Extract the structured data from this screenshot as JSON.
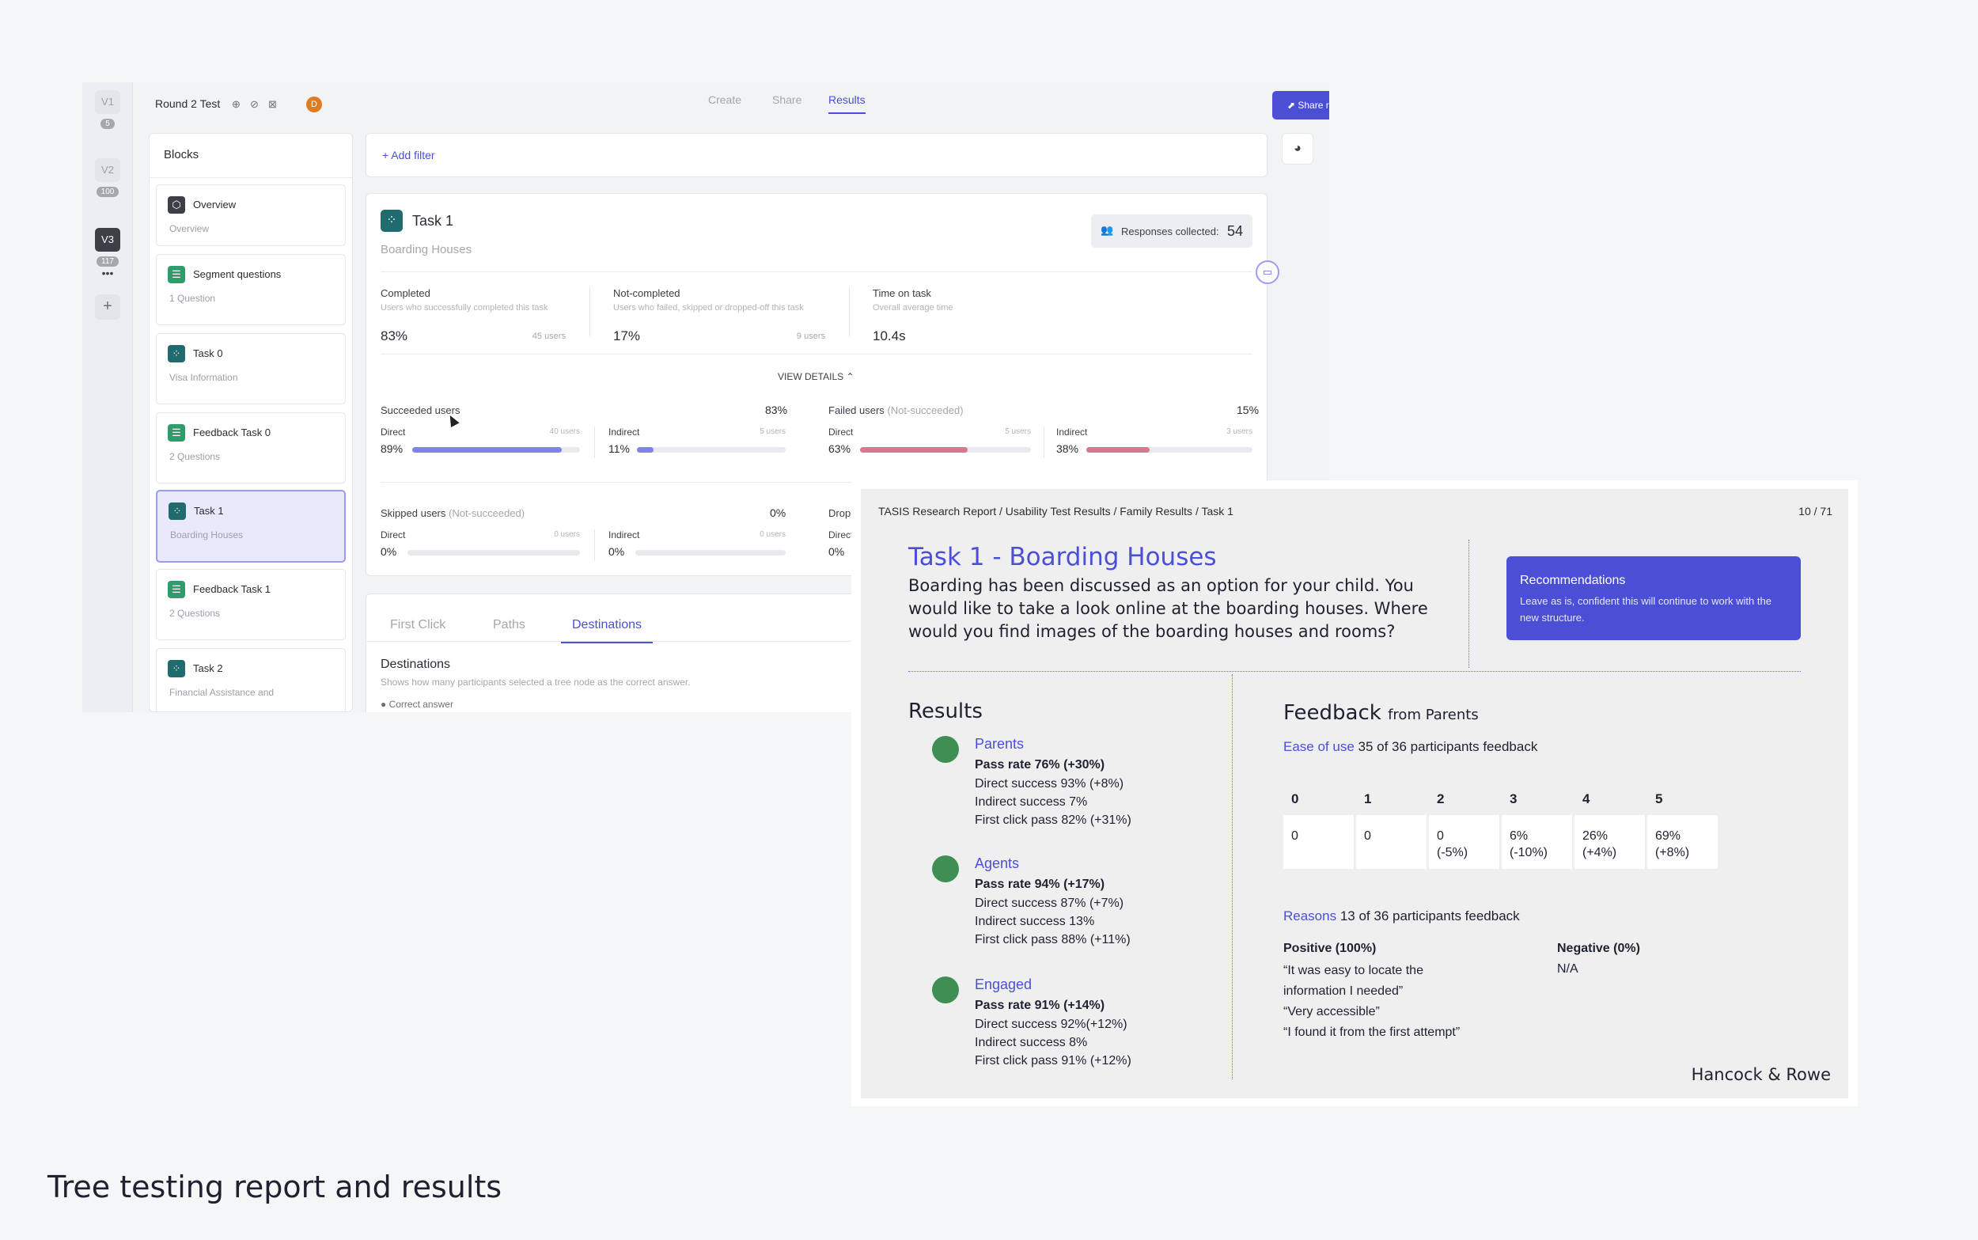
{
  "app": {
    "versions": [
      {
        "label": "V1",
        "count": "5"
      },
      {
        "label": "V2",
        "count": "100"
      },
      {
        "label": "V3",
        "count": "117"
      }
    ],
    "add_version": "+",
    "project_title": "Round 2 Test",
    "avatar": "D",
    "nav_tabs": [
      {
        "label": "Create"
      },
      {
        "label": "Share"
      },
      {
        "label": "Results"
      }
    ],
    "share_button": "⬈ Share results",
    "blocks_title": "Blocks",
    "blocks": [
      {
        "icon": "⬡",
        "title": "Overview",
        "subtitle": "Overview"
      },
      {
        "icon": "☰",
        "title": "Segment questions",
        "subtitle": "1 Question"
      },
      {
        "icon": "⁘",
        "title": "Task 0",
        "subtitle": "Visa Information"
      },
      {
        "icon": "☰",
        "title": "Feedback Task 0",
        "subtitle": "2 Questions"
      },
      {
        "icon": "⁘",
        "title": "Task 1",
        "subtitle": "Boarding Houses"
      },
      {
        "icon": "☰",
        "title": "Feedback Task 1",
        "subtitle": "2 Questions"
      },
      {
        "icon": "⁘",
        "title": "Task 2",
        "subtitle": "Financial Assistance and"
      }
    ],
    "add_filter": "+  Add filter",
    "task": {
      "title": "Task 1",
      "subtitle": "Boarding Houses",
      "responses_label": "Responses collected:",
      "responses_value": "54",
      "stats": [
        {
          "label": "Completed",
          "desc": "Users who successfully completed this task",
          "value": "83%",
          "users": "45 users"
        },
        {
          "label": "Not-completed",
          "desc": "Users who failed, skipped or dropped-off this task",
          "value": "17%",
          "users": "9 users"
        },
        {
          "label": "Time on task",
          "desc": "Overall average time",
          "value": "10.4s",
          "users": ""
        }
      ],
      "view_details": "VIEW DETAILS ⌃",
      "groups": {
        "succeeded": {
          "label": "Succeeded users",
          "muted": "",
          "pct": "83%",
          "direct": {
            "label": "Direct",
            "users": "40 users",
            "pct": "89%",
            "fill": 0.89
          },
          "indirect": {
            "label": "Indirect",
            "users": "5 users",
            "pct": "11%",
            "fill": 0.11
          }
        },
        "failed": {
          "label": "Failed users",
          "muted": "(Not-succeeded)",
          "pct": "15%",
          "direct": {
            "label": "Direct",
            "users": "5 users",
            "pct": "63%",
            "fill": 0.63
          },
          "indirect": {
            "label": "Indirect",
            "users": "3 users",
            "pct": "38%",
            "fill": 0.38
          }
        },
        "skipped": {
          "label": "Skipped users",
          "muted": "(Not-succeeded)",
          "pct": "0%",
          "direct": {
            "label": "Direct",
            "users": "0 users",
            "pct": "0%",
            "fill": 0
          },
          "indirect": {
            "label": "Indirect",
            "users": "0 users",
            "pct": "0%",
            "fill": 0
          }
        },
        "dropped": {
          "label": "Drop",
          "direct_label": "Direct",
          "direct_pct": "0%"
        }
      },
      "colors": {
        "success": "#7f83ee",
        "fail": "#d57a8c",
        "accent": "#4b4fd6"
      }
    },
    "subtabs": [
      {
        "label": "First Click"
      },
      {
        "label": "Paths"
      },
      {
        "label": "Destinations"
      }
    ],
    "destinations_title": "Destinations",
    "destinations_desc": "Shows how many participants selected a tree node as the correct answer.",
    "correct_answer": "● Correct answer"
  },
  "slide": {
    "breadcrumb": "TASIS Research Report / Usability Test Results / Family Results / Task 1",
    "page": "10 / 71",
    "title": "Task 1 - Boarding Houses",
    "question": "Boarding has been discussed as an option for your child. You would like to take a look online at the boarding houses. Where would you find images of the boarding houses and rooms?",
    "recommendations_title": "Recommendations",
    "recommendations_text": "Leave as is, confident this will continue to work with the new structure.",
    "results_heading": "Results",
    "segments": [
      {
        "name": "Parents",
        "pass": "Pass rate 76% (+30%)",
        "lines": [
          "Direct success 93% (+8%)",
          "Indirect success 7%",
          "First click pass 82% (+31%)"
        ]
      },
      {
        "name": "Agents",
        "pass": "Pass rate 94% (+17%)",
        "lines": [
          "Direct success 87% (+7%)",
          "Indirect success 13%",
          "First click pass 88% (+11%)"
        ]
      },
      {
        "name": "Engaged",
        "pass": "Pass rate 91% (+14%)",
        "lines": [
          "Direct success 92%(+12%)",
          "Indirect success 8%",
          "First click pass 91% (+12%)"
        ]
      }
    ],
    "feedback_heading": "Feedback",
    "feedback_from": "from Parents",
    "ease_label": "Ease of use",
    "ease_count": "35 of 36 participants feedback",
    "ease_table": [
      {
        "head": "0",
        "value": "0"
      },
      {
        "head": "1",
        "value": "0"
      },
      {
        "head": "2",
        "value": "0\n(-5%)"
      },
      {
        "head": "3",
        "value": "6%\n(-10%)"
      },
      {
        "head": "4",
        "value": "26%\n(+4%)"
      },
      {
        "head": "5",
        "value": "69%\n(+8%)"
      }
    ],
    "reasons_label": "Reasons",
    "reasons_count": "13 of 36 participants feedback",
    "positive_heading": "Positive (100%)",
    "positive_quotes": [
      "“It was easy to locate the",
      "information I needed”",
      "“Very accessible”",
      "“I found it from the first attempt”"
    ],
    "negative_heading": "Negative (0%)",
    "negative_value": "N/A",
    "brand": "Hancock & Rowe",
    "colors": {
      "accent": "#4b4fd6",
      "segment_dot": "#3f8f55"
    }
  },
  "caption": "Tree testing report and results"
}
